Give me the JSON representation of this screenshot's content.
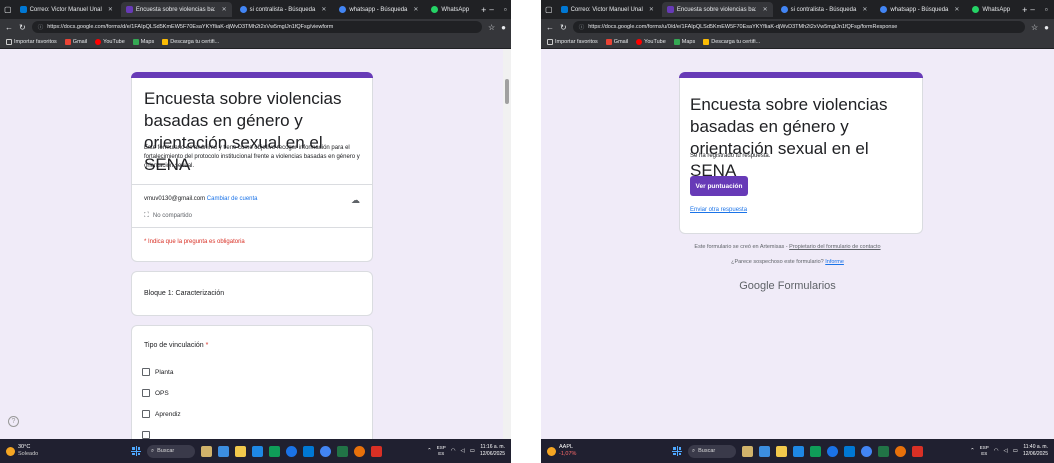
{
  "colors": {
    "accent": "#673ab7",
    "link": "#1a73e8",
    "required": "#d93025",
    "page_bg": "#f0ebf8"
  },
  "left": {
    "tabs": [
      {
        "label": "Correo: Victor Manuel Unal",
        "icon": "outlook-icon",
        "color": "#0078d4"
      },
      {
        "label": "Encuesta sobre violencias ba:",
        "icon": "forms-icon",
        "color": "#673ab7",
        "active": true
      },
      {
        "label": "si contralista - Búsqueda",
        "icon": "search-icon",
        "color": "#4285f4"
      },
      {
        "label": "whatsapp - Búsqueda",
        "icon": "search-icon",
        "color": "#4285f4"
      },
      {
        "label": "WhatsApp",
        "icon": "whatsapp-icon",
        "color": "#25d366"
      }
    ],
    "url": "https://docs.google.com/forms/d/e/1FAIpQLSd5KmEW5F70EsaYKYfIiaK-djWvD3TMh2t2xVw5mglJn1fQFsg/viewform",
    "bookmarks": [
      "Importar favoritos",
      "Gmail",
      "YouTube",
      "Maps",
      "Descarga tu certifi..."
    ],
    "form_title": "Encuesta sobre violencias basadas en género y orientación sexual en el SENA",
    "form_description": "Este formulario es anónimo y tiene como objetivo recoger información para el fortalecimiento del protocolo institucional frente a violencias basadas en género y orientación sexual.",
    "email": "vmuv0130@gmail.com",
    "switch_account": "Cambiar de cuenta",
    "not_shared": "No compartido",
    "required_note": "* Indica que la pregunta es obligatoria",
    "section_title": "Bloque 1: Caracterización",
    "question": "Tipo de vinculación",
    "required_mark": "*",
    "options": [
      "Planta",
      "OPS",
      "Aprendiz"
    ],
    "weather": {
      "temp": "30°C",
      "condition": "Soleado"
    },
    "clock": {
      "time": "11:16 a. m.",
      "date": "12/06/2025"
    },
    "lang": {
      "top": "ESP",
      "bottom": "ES"
    },
    "search_label": "Buscar"
  },
  "right": {
    "tabs": [
      {
        "label": "Correo: Victor Manuel Unal",
        "icon": "outlook-icon",
        "color": "#0078d4"
      },
      {
        "label": "Encuesta sobre violencias ba:",
        "icon": "forms-icon",
        "color": "#673ab7",
        "active": true
      },
      {
        "label": "si contralista - Búsqueda",
        "icon": "search-icon",
        "color": "#4285f4"
      },
      {
        "label": "whatsapp - Búsqueda",
        "icon": "search-icon",
        "color": "#4285f4"
      },
      {
        "label": "WhatsApp",
        "icon": "whatsapp-icon",
        "color": "#25d366"
      }
    ],
    "url": "https://docs.google.com/forms/u/0/d/e/1FAIpQLSd5KmEW5F70EsaYKYfIiaK-djWvD3TMh2t2xVw5mglJn1fQFsg/formResponse",
    "bookmarks": [
      "Importar favoritos",
      "Gmail",
      "YouTube",
      "Maps",
      "Descarga tu certifi..."
    ],
    "form_title": "Encuesta sobre violencias basadas en género y orientación sexual en el SENA",
    "confirmation": "Se ha registrado tu respuesta.",
    "score_button": "Ver puntuación",
    "another_response": "Enviar otra respuesta",
    "footer_created": "Este formulario se creó en Artemisas -",
    "footer_contact": "Propietario del formulario de contacto",
    "footer_suspicious": "¿Parece sospechoso este formulario?",
    "footer_report": "Informe",
    "brand": "Google Formularios",
    "stock": {
      "ticker": "AAPL",
      "change": "-1,07%"
    },
    "clock": {
      "time": "11:40 a. m.",
      "date": "12/06/2025"
    },
    "lang": {
      "top": "ESP",
      "bottom": "ES"
    },
    "search_label": "Buscar"
  }
}
